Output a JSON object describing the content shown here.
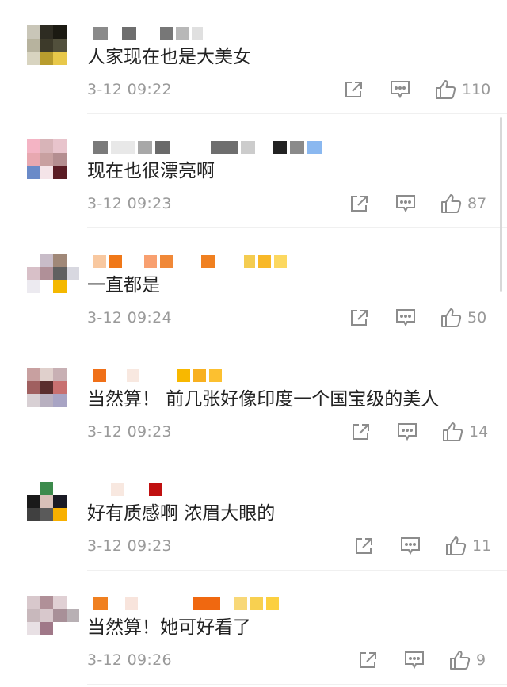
{
  "comments": [
    {
      "text": "人家现在也是大美女",
      "time": "3-12 09:22",
      "likes": "110",
      "avatar_colors": [
        "#c9c6b8",
        "#2e2c22",
        "#1b1a12",
        "#ffffff",
        "#b7b39e",
        "#3d3a2a",
        "#52503c",
        "#ffffff",
        "#d8d4c0",
        "#b89c2e",
        "#e8c84a",
        "#ffffff"
      ],
      "name_blocks": [
        [
          "#8a8a8a",
          18
        ],
        [
          "#ffffff",
          10
        ],
        [
          "#6e6e6e",
          18
        ],
        [
          "#ffffff",
          22
        ],
        [
          "#777777",
          16
        ],
        [
          "#b8b8b8",
          16
        ],
        [
          "#e0e0e0",
          14
        ]
      ]
    },
    {
      "text": "现在也很漂亮啊",
      "time": "3-12 09:23",
      "likes": "87",
      "avatar_colors": [
        "#f4b4c4",
        "#d8b4b8",
        "#e8c4cc",
        "#ffffff",
        "#e8a8b0",
        "#c8a0a0",
        "#b48e90",
        "#ffffff",
        "#6a8ac8",
        "#f4e4e8",
        "#5a1c24",
        "#ffffff"
      ],
      "name_blocks": [
        [
          "#7a7a7a",
          18
        ],
        [
          "#e8e8e8",
          30
        ],
        [
          "#a8a8a8",
          18
        ],
        [
          "#6a6a6a",
          18
        ],
        [
          "#ffffff",
          44
        ],
        [
          "#6e6e6e",
          34
        ],
        [
          "#cccccc",
          18
        ],
        [
          "#ffffff",
          14
        ],
        [
          "#222222",
          18
        ],
        [
          "#8a8a8a",
          18
        ],
        [
          "#8ab8f0",
          18
        ]
      ]
    },
    {
      "text": "一直都是",
      "time": "3-12 09:24",
      "likes": "50",
      "avatar_colors": [
        "#ffffff",
        "#c8bcc8",
        "#a08878",
        "#ffffff",
        "#d8c0c8",
        "#b09098",
        "#606060",
        "#d8d8e0",
        "#eceaf0",
        "#ffffff",
        "#f4b800",
        "#ffffff"
      ],
      "name_blocks": [
        [
          "#f8c8a0",
          16
        ],
        [
          "#f07818",
          16
        ],
        [
          "#ffffff",
          20
        ],
        [
          "#f8a070",
          16
        ],
        [
          "#f08838",
          16
        ],
        [
          "#ffffff",
          28
        ],
        [
          "#f08020",
          18
        ],
        [
          "#ffffff",
          28
        ],
        [
          "#f4cc50",
          14
        ],
        [
          "#f8b828",
          16
        ],
        [
          "#fcd860",
          16
        ]
      ]
    },
    {
      "text": "当然算！ 前几张好像印度一个国宝级的美人",
      "time": "3-12 09:23",
      "likes": "14",
      "avatar_colors": [
        "#c8a0a0",
        "#e0d0cc",
        "#c8b0b4",
        "#ffffff",
        "#a06060",
        "#5a2e2e",
        "#c87070",
        "#ffffff",
        "#d8d0d4",
        "#b8b0c0",
        "#a8a4c4",
        "#ffffff"
      ],
      "name_blocks": [
        [
          "#f07018",
          16
        ],
        [
          "#ffffff",
          18
        ],
        [
          "#f8e8e0",
          16
        ],
        [
          "#ffffff",
          40
        ],
        [
          "#f8b800",
          16
        ],
        [
          "#f8b020",
          16
        ],
        [
          "#fcc030",
          16
        ]
      ]
    },
    {
      "text": "好有质感啊 浓眉大眼的",
      "time": "3-12 09:23",
      "likes": "11",
      "avatar_colors": [
        "#ffffff",
        "#3c8a4c",
        "#ffffff",
        "#ffffff",
        "#1a1a1a",
        "#d8c0b8",
        "#1a1a24",
        "#ffffff",
        "#404040",
        "#5a5a5a",
        "#f8b000",
        "#ffffff"
      ],
      "name_blocks": [
        [
          "#ffffff",
          18
        ],
        [
          "#f8e8e0",
          16
        ],
        [
          "#ffffff",
          24
        ],
        [
          "#c01010",
          16
        ]
      ]
    },
    {
      "text": "当然算！她可好看了",
      "time": "3-12 09:26",
      "likes": "9",
      "avatar_colors": [
        "#d8c8cc",
        "#b09098",
        "#e0d0d4",
        "#ffffff",
        "#c8b8bc",
        "#d8c8cc",
        "#a89098",
        "#b8b0b4",
        "#e8e0e4",
        "#a07888",
        "#ffffff",
        "#ffffff"
      ],
      "name_blocks": [
        [
          "#f08020",
          18
        ],
        [
          "#ffffff",
          14
        ],
        [
          "#f8e4dc",
          16
        ],
        [
          "#ffffff",
          62
        ],
        [
          "#f06810",
          34
        ],
        [
          "#ffffff",
          10
        ],
        [
          "#f8d878",
          16
        ],
        [
          "#f8d050",
          16
        ],
        [
          "#fcd040",
          16
        ]
      ]
    }
  ],
  "icons": [
    "share-icon",
    "comment-icon",
    "like-icon"
  ]
}
